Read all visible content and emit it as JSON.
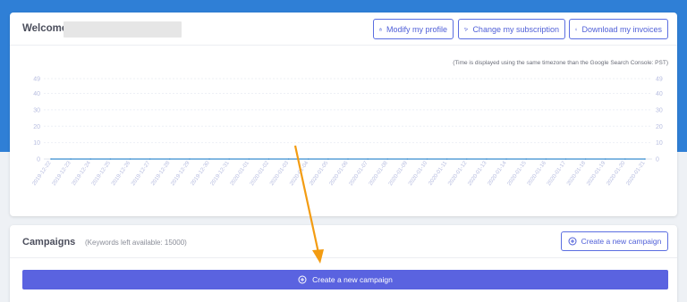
{
  "welcome": {
    "title": "Welcome",
    "buttons": {
      "modify_profile": "Modify my profile",
      "change_subscription": "Change my subscription",
      "download_invoices": "Download my invoices"
    },
    "timezone_note": "(Time is displayed using the same timezone than the Google Search Console: PST)"
  },
  "chart_data": {
    "type": "line",
    "x": [
      "2019-12-22",
      "2019-12-23",
      "2019-12-24",
      "2019-12-25",
      "2019-12-26",
      "2019-12-27",
      "2019-12-28",
      "2019-12-29",
      "2019-12-30",
      "2019-12-31",
      "2020-01-01",
      "2020-01-02",
      "2020-01-03",
      "2020-01-04",
      "2020-01-05",
      "2020-01-06",
      "2020-01-07",
      "2020-01-08",
      "2020-01-09",
      "2020-01-10",
      "2020-01-11",
      "2020-01-12",
      "2020-01-13",
      "2020-01-14",
      "2020-01-15",
      "2020-01-16",
      "2020-01-17",
      "2020-01-18",
      "2020-01-19",
      "2020-01-20",
      "2020-01-21"
    ],
    "series": [
      {
        "values": [
          0,
          0,
          0,
          0,
          0,
          0,
          0,
          0,
          0,
          0,
          0,
          0,
          0,
          0,
          0,
          0,
          0,
          0,
          0,
          0,
          0,
          0,
          0,
          0,
          0,
          0,
          0,
          0,
          0,
          0,
          0
        ]
      }
    ],
    "yticks": [
      0,
      10,
      20,
      30,
      40,
      49
    ],
    "ylim": [
      0,
      49
    ],
    "grid": true,
    "colors": {
      "line": "#5aa0d8",
      "tick": "#b7bde0",
      "grid": "#eef0f6"
    }
  },
  "campaigns": {
    "title": "Campaigns",
    "subtitle": "(Keywords left available: 15000)",
    "create_top": "Create a new campaign",
    "create_main": "Create a new campaign"
  },
  "colors": {
    "brand": "#5a63e0",
    "header_bg": "#2f7fd6",
    "annotation_arrow": "#f39c12"
  }
}
